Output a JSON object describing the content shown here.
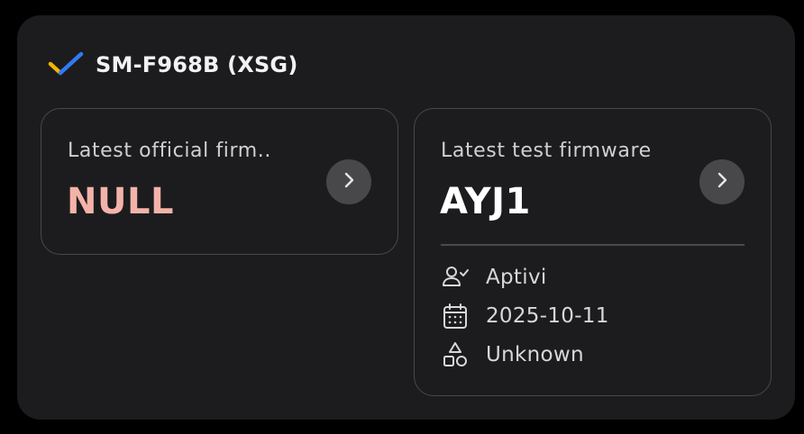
{
  "device": {
    "title": "SM-F968B (XSG)",
    "verified_icon": "checkmark-icon"
  },
  "official_card": {
    "label": "Latest official firm..",
    "value": "NULL",
    "value_color": "#f4b3a9"
  },
  "test_card": {
    "label": "Latest test firmware",
    "value": "AYJ1",
    "details": [
      {
        "icon": "person-check-icon",
        "text": "Aptivi"
      },
      {
        "icon": "calendar-icon",
        "text": "2025-10-11"
      },
      {
        "icon": "shapes-icon",
        "text": "Unknown"
      }
    ]
  },
  "colors": {
    "background": "#000000",
    "widget": "#1c1c1e",
    "card_border": "#48484a",
    "check_blue": "#2f7bf6",
    "check_yellow": "#f5b400"
  }
}
